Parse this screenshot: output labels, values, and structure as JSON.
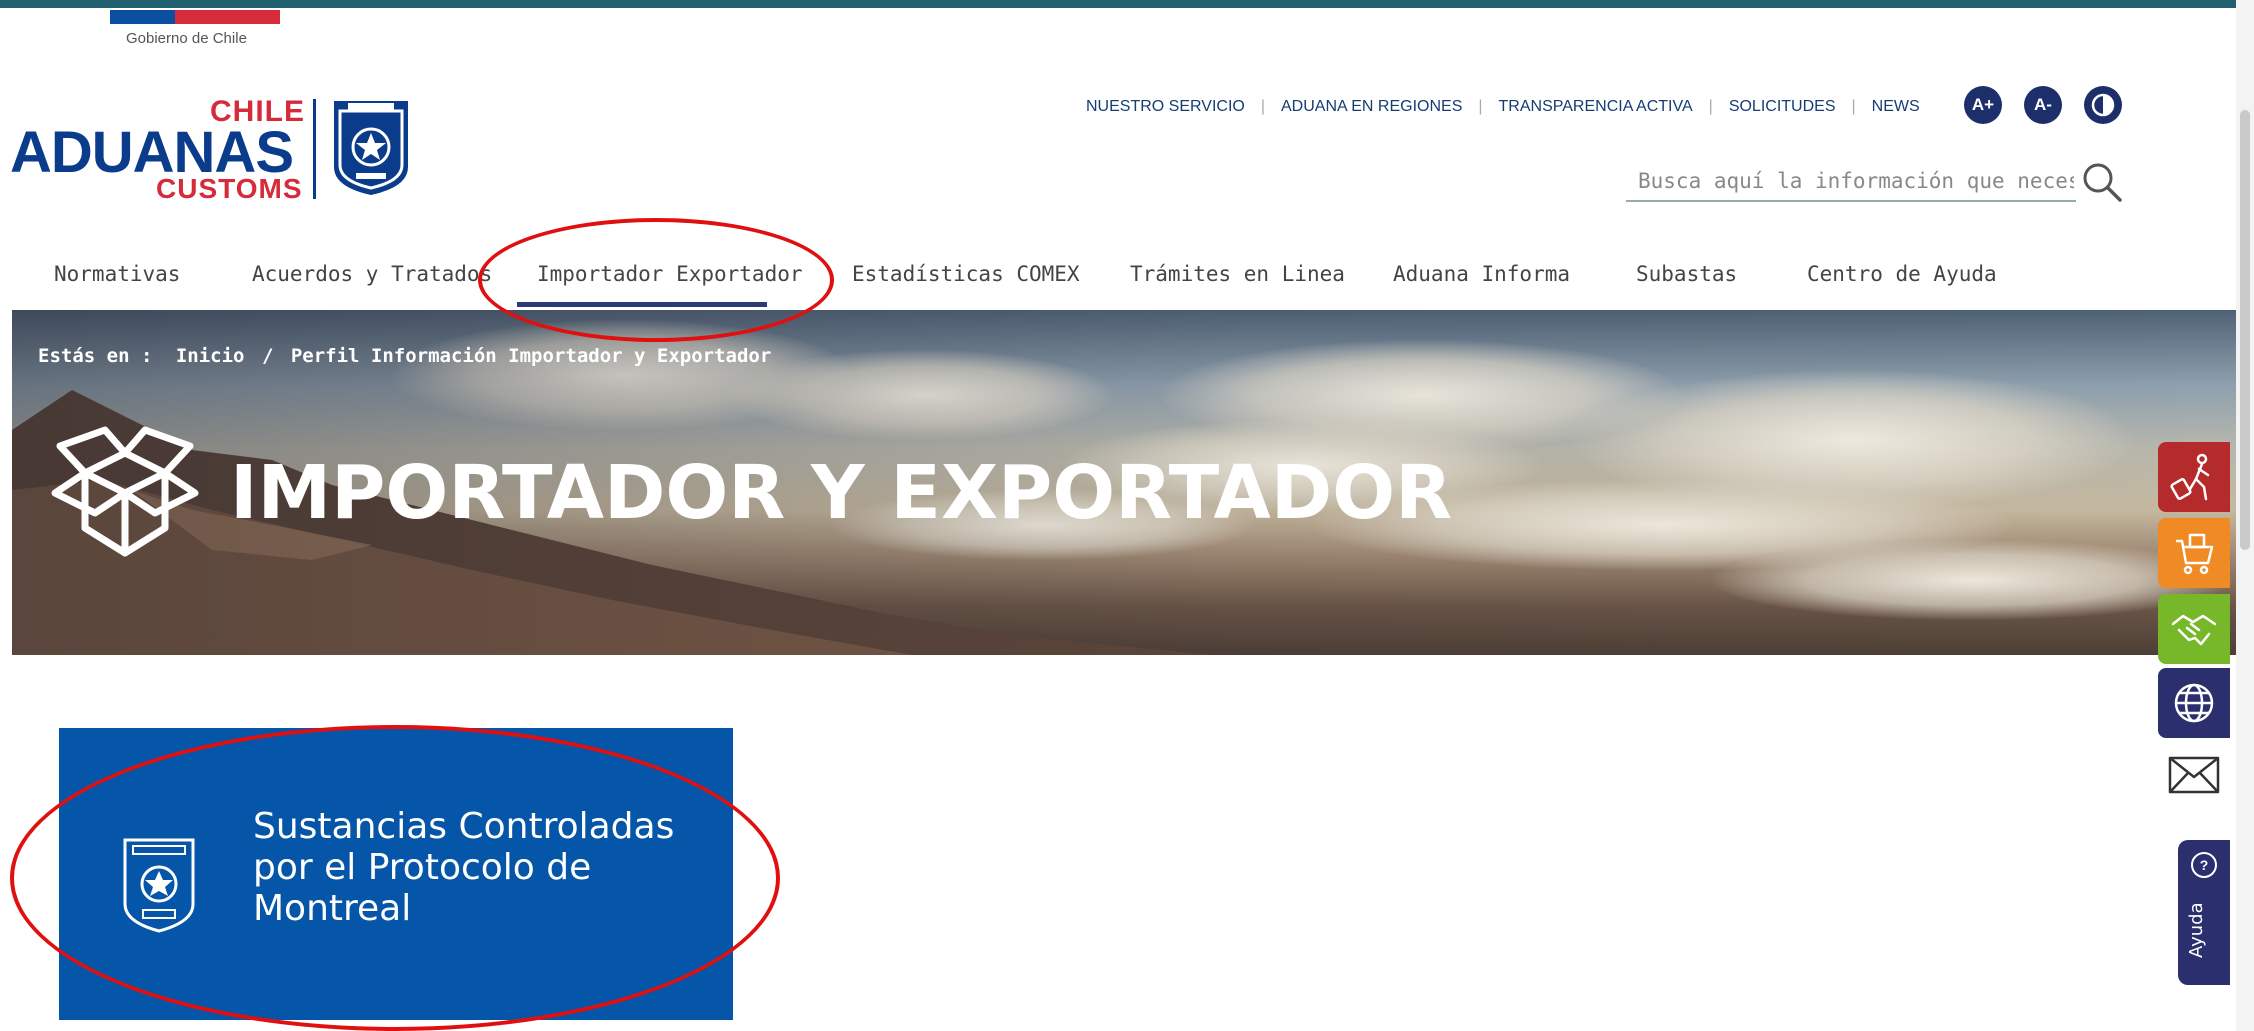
{
  "gov": {
    "label": "Gobierno de Chile"
  },
  "logo": {
    "top": "CHILE",
    "main": "ADUANAS",
    "bottom": "CUSTOMS"
  },
  "top_links": [
    "NUESTRO SERVICIO",
    "ADUANA EN REGIONES",
    "TRANSPARENCIA ACTIVA",
    "SOLICITUDES",
    "NEWS"
  ],
  "a11y": {
    "increase": "A+",
    "decrease": "A-",
    "contrast_icon": "contrast-icon"
  },
  "search": {
    "placeholder": "Busca aquí la información que necesitas...",
    "icon": "search-icon"
  },
  "nav": {
    "items": [
      "Normativas",
      "Acuerdos y Tratados",
      "Importador Exportador",
      "Estadísticas COMEX",
      "Trámites en Linea",
      "Aduana Informa",
      "Subastas",
      "Centro de Ayuda"
    ],
    "active": "Importador Exportador"
  },
  "breadcrumb": {
    "prefix": "Estás en :",
    "home": "Inicio",
    "separator": "/",
    "current": "Perfil Información Importador y Exportador"
  },
  "hero": {
    "title": "IMPORTADOR Y EXPORTADOR",
    "icon": "open-box-icon"
  },
  "card": {
    "title": "Sustancias Controladas por el Protocolo de Montreal",
    "icon": "aduanas-badge-icon"
  },
  "side_tools": [
    {
      "icon": "traveler-icon",
      "color": "#b52a2a"
    },
    {
      "icon": "cart-icon",
      "color": "#f08a24"
    },
    {
      "icon": "handshake-icon",
      "color": "#76b82a"
    },
    {
      "icon": "globe-icon",
      "color": "#2b2f6e"
    },
    {
      "icon": "mail-icon",
      "color": "#ffffff"
    }
  ],
  "help": {
    "label": "Ayuda",
    "symbol": "?"
  },
  "colors": {
    "brand_blue": "#0b3c8c",
    "brand_red": "#d52b3a",
    "card_blue": "#0556a8",
    "nav_active": "#2b3a78",
    "annotation_red": "#e01010"
  }
}
